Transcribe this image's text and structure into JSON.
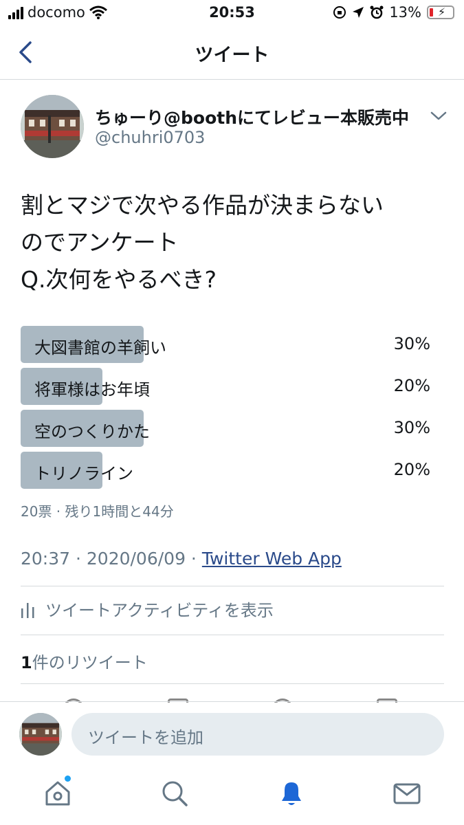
{
  "status_bar": {
    "carrier": "docomo",
    "time": "20:53",
    "battery": "13%"
  },
  "nav": {
    "title": "ツイート"
  },
  "tweet": {
    "author_name": "ちゅーり@boothにてレビュー本販売中",
    "author_handle": "@chuhri0703",
    "text_lines": [
      "割とマジで次やる作品が決まらない",
      "のでアンケート",
      "Q.次何をやるべき?"
    ],
    "poll": {
      "options": [
        {
          "label": "大図書館の羊飼い",
          "percent": "30%",
          "value": 30
        },
        {
          "label": "将軍様はお年頃",
          "percent": "20%",
          "value": 20
        },
        {
          "label": "空のつくりかた",
          "percent": "30%",
          "value": 30
        },
        {
          "label": "トリノライン",
          "percent": "20%",
          "value": 20
        }
      ],
      "meta": "20票 · 残り1時間と44分"
    },
    "timestamp": "20:37 · 2020/06/09 · ",
    "source": "Twitter Web App",
    "activity_label": "ツイートアクティビティを表示",
    "retweet_count": "1",
    "retweet_label": "件のリツイート"
  },
  "reply": {
    "placeholder": "ツイートを追加"
  },
  "tabs": [
    "home-icon",
    "search-icon",
    "notifications-icon",
    "messages-icon"
  ],
  "colors": {
    "accent": "#1da1f2",
    "poll_bar": "#aab8c2",
    "secondary_text": "#657786",
    "nav_icon": "#2a4a8a"
  }
}
